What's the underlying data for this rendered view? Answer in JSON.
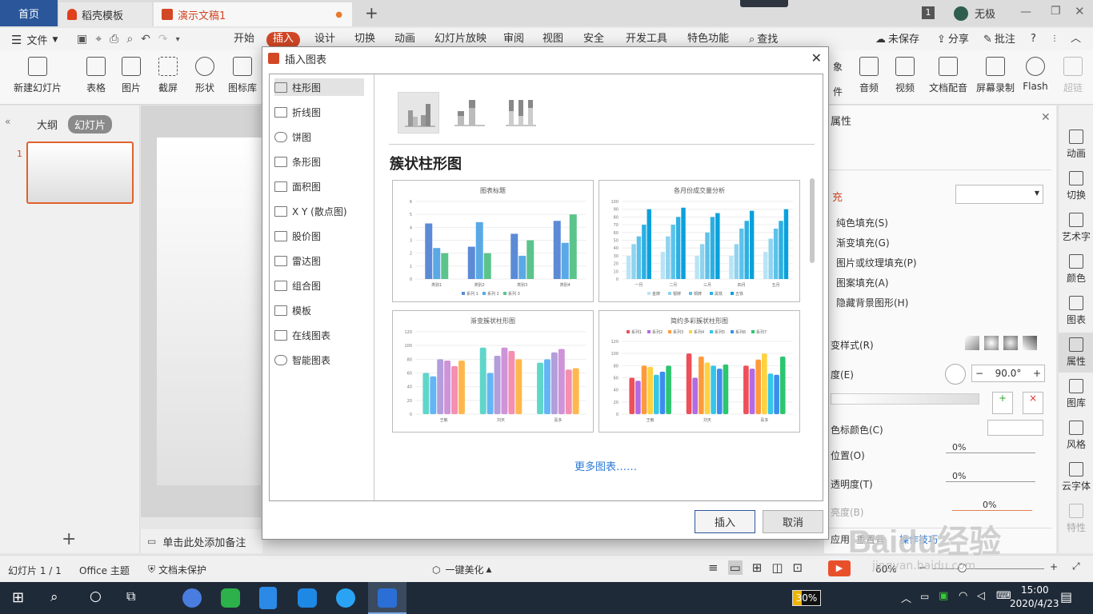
{
  "tabs": {
    "home": "首页",
    "template": "稻壳模板",
    "doc": "演示文稿1",
    "user": "无极",
    "badge": "1"
  },
  "menu": {
    "file": "文件",
    "items": [
      "开始",
      "插入",
      "设计",
      "切换",
      "动画",
      "幻灯片放映",
      "审阅",
      "视图",
      "安全",
      "开发工具",
      "特色功能"
    ],
    "search": "查找",
    "unsaved": "未保存",
    "share": "分享",
    "comment": "批注"
  },
  "ribbon": {
    "new_slide": "新建幻灯片",
    "table": "表格",
    "picture": "图片",
    "screenshot": "截屏",
    "shape": "形状",
    "icon_lib": "图标库",
    "obj_partial": "象",
    "part2": "件",
    "audio": "音频",
    "video": "视频",
    "text_audio": "文档配音",
    "screen_rec": "屏幕录制",
    "flash": "Flash",
    "hyperlink": "超链"
  },
  "left_panel": {
    "outline": "大纲",
    "slides": "幻灯片",
    "slide_number": "1",
    "notes_placeholder": "单击此处添加备注"
  },
  "right_panel": {
    "title": "属性",
    "fill_label": "充",
    "options": [
      "纯色填充(S)",
      "渐变填充(G)",
      "图片或纹理填充(P)",
      "图案填充(A)",
      "隐藏背景图形(H)"
    ],
    "gradient_style": "变样式(R)",
    "angle_label": "度(E)",
    "angle_value": "90.0°",
    "stop_color": "色标颜色(C)",
    "position": "位置(O)",
    "position_value": "0%",
    "transparency": "透明度(T)",
    "transparency_value": "0%",
    "brightness": "亮度(B)",
    "brightness_value": "0%",
    "apply_all": "应用",
    "reset": "重置背",
    "tips": "操作技巧"
  },
  "right_bar": [
    "动画",
    "切换",
    "艺术字",
    "颜色",
    "图表",
    "属性",
    "图库",
    "风格",
    "云字体",
    "特性"
  ],
  "status": {
    "slide": "幻灯片 1 / 1",
    "theme": "Office 主题",
    "protect": "文档未保护",
    "beautify": "一键美化",
    "zoom": "60%"
  },
  "taskbar": {
    "battery": "30%",
    "time": "15:00",
    "date": "2020/4/23"
  },
  "watermark": {
    "brand": "Baidu经验",
    "url": "jingyan.baidu.com"
  },
  "dialog": {
    "title": "插入图表",
    "categories": [
      "柱形图",
      "折线图",
      "饼图",
      "条形图",
      "面积图",
      "X Y (散点图)",
      "股价图",
      "雷达图",
      "组合图",
      "模板",
      "在线图表",
      "智能图表"
    ],
    "section_title": "簇状柱形图",
    "more": "更多图表……",
    "insert": "插入",
    "cancel": "取消",
    "thumbs": [
      {
        "title": "图表标题",
        "categories": [
          "类别1",
          "类别2",
          "类别3",
          "类别4"
        ],
        "legend": [
          "系列 1",
          "系列 2",
          "系列 3"
        ],
        "ticks": [
          "6",
          "5",
          "4",
          "3",
          "2",
          "1",
          "0"
        ],
        "series": [
          {
            "color": "#5b8bd6",
            "values": [
              4.3,
              2.5,
              3.5,
              4.5
            ]
          },
          {
            "color": "#5aa9e6",
            "values": [
              2.4,
              4.4,
              1.8,
              2.8
            ]
          },
          {
            "color": "#5bc48b",
            "values": [
              2.0,
              2.0,
              3.0,
              5.0
            ]
          }
        ]
      },
      {
        "title": "各月份成交量分析",
        "categories": [
          "一月",
          "二月",
          "三月",
          "四月",
          "五月"
        ],
        "legend": [
          "金牌",
          "银牌",
          "铜牌",
          "黑铁",
          "五铁"
        ],
        "ticks": [
          "100",
          "90",
          "80",
          "70",
          "60",
          "50",
          "40",
          "30",
          "20",
          "10",
          "0"
        ],
        "series": [
          {
            "color": "#b8e4f5",
            "values": [
              30,
              35,
              30,
              30,
              35
            ]
          },
          {
            "color": "#8ed3f0",
            "values": [
              45,
              55,
              45,
              45,
              52
            ]
          },
          {
            "color": "#5cc2ea",
            "values": [
              55,
              70,
              60,
              65,
              65
            ]
          },
          {
            "color": "#2bb0e3",
            "values": [
              70,
              80,
              80,
              75,
              75
            ]
          },
          {
            "color": "#0aa0dc",
            "values": [
              90,
              92,
              85,
              88,
              90
            ]
          }
        ]
      },
      {
        "title": "渐变簇状柱形图",
        "categories": [
          "王敏",
          "刘天",
          "喜多"
        ],
        "ticks": [
          "120",
          "100",
          "80",
          "60",
          "40",
          "20",
          "0"
        ],
        "series": [
          {
            "color": "#5fd6c9",
            "values": [
              60,
              97,
              75
            ]
          },
          {
            "color": "#64b5f6",
            "values": [
              55,
              60,
              80
            ]
          },
          {
            "color": "#b39ddb",
            "values": [
              80,
              85,
              90
            ]
          },
          {
            "color": "#ce93d8",
            "values": [
              78,
              97,
              95
            ]
          },
          {
            "color": "#f48fb1",
            "values": [
              70,
              92,
              65
            ]
          },
          {
            "color": "#ffb74d",
            "values": [
              78,
              80,
              67
            ]
          }
        ]
      },
      {
        "title": "简约多彩簇状柱形图",
        "categories": [
          "王敏",
          "刘天",
          "喜多"
        ],
        "legend": [
          "系列1",
          "系列2",
          "系列3",
          "系列4",
          "系列5",
          "系列6",
          "系列7"
        ],
        "ticks": [
          "120",
          "100",
          "80",
          "60",
          "40",
          "20",
          "0"
        ],
        "series": [
          {
            "color": "#ef4f5a",
            "values": [
              60,
              100,
              80
            ]
          },
          {
            "color": "#b36ae2",
            "values": [
              55,
              60,
              75
            ]
          },
          {
            "color": "#ff9a3c",
            "values": [
              80,
              95,
              90
            ]
          },
          {
            "color": "#ffd23f",
            "values": [
              78,
              85,
              100
            ]
          },
          {
            "color": "#36c6e8",
            "values": [
              65,
              80,
              67
            ]
          },
          {
            "color": "#3b8ef0",
            "values": [
              70,
              75,
              65
            ]
          },
          {
            "color": "#2cc66f",
            "values": [
              80,
              82,
              95
            ]
          }
        ]
      }
    ]
  }
}
